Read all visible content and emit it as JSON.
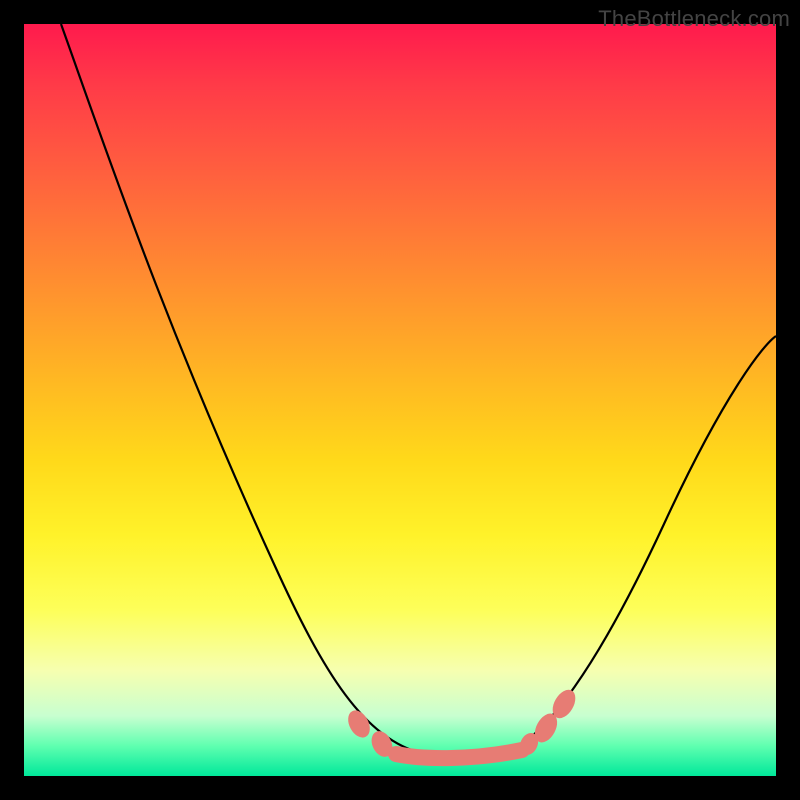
{
  "watermark": "TheBottleneck.com",
  "chart_data": {
    "type": "line",
    "title": "",
    "xlabel": "",
    "ylabel": "",
    "xlim": [
      0,
      100
    ],
    "ylim": [
      0,
      100
    ],
    "series": [
      {
        "name": "bottleneck-curve",
        "x": [
          5,
          10,
          15,
          20,
          25,
          30,
          35,
          40,
          45,
          48,
          50,
          52,
          55,
          58,
          60,
          62,
          65,
          70,
          75,
          80,
          85,
          90,
          95,
          100
        ],
        "y": [
          100,
          88,
          76,
          65,
          54,
          44,
          34,
          25,
          16,
          11,
          8,
          5,
          3,
          2,
          2,
          2,
          3,
          6,
          12,
          20,
          30,
          41,
          53,
          55
        ]
      }
    ],
    "markers": {
      "name": "highlight-points",
      "x": [
        45,
        48,
        50,
        53,
        56,
        59,
        62,
        64,
        66,
        68
      ],
      "y": [
        11,
        7,
        4,
        3,
        2,
        2,
        2,
        3,
        5,
        8
      ]
    },
    "valley_segment": {
      "x_start": 50,
      "x_end": 66,
      "y": 2
    }
  }
}
